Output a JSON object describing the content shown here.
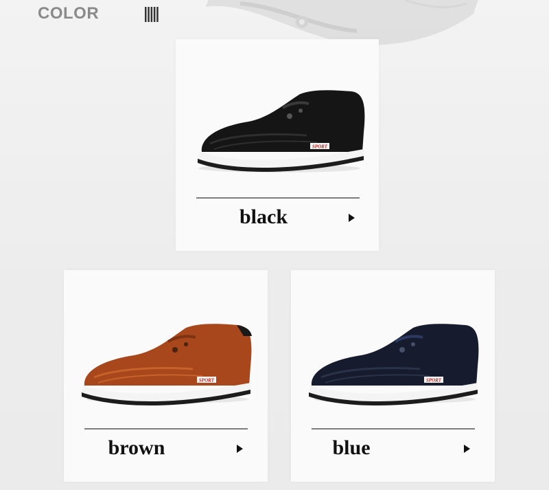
{
  "header": {
    "title": "COLOR",
    "decoration_icon": "vertical-stripes-icon"
  },
  "colors": {
    "black": {
      "label": "black",
      "upper": "#151515",
      "shade": "#2e2e2e"
    },
    "brown": {
      "label": "brown",
      "upper": "#a8461c",
      "shade": "#c7622a"
    },
    "blue": {
      "label": "blue",
      "upper": "#161c2d",
      "shade": "#2a3249"
    }
  },
  "sole_logo_text": "SPORT",
  "arrow_icon": "play-arrow-icon"
}
